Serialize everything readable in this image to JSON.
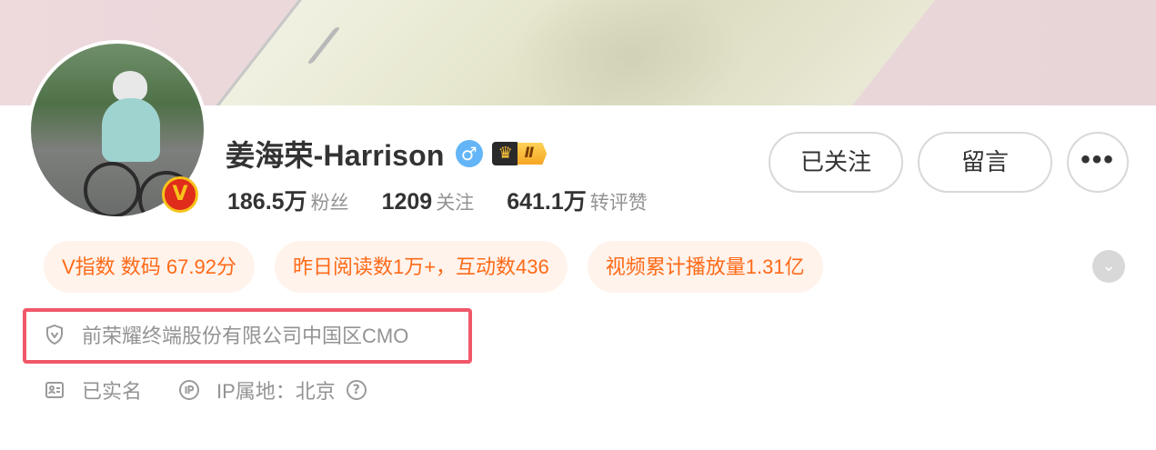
{
  "profile": {
    "name": "姜海荣-Harrison",
    "gender_icon": "male-icon",
    "level": "Ⅱ",
    "verified_badge": "V",
    "accent_color": "#ff6a18"
  },
  "stats": [
    {
      "num": "186.5万",
      "label": "粉丝"
    },
    {
      "num": "1209",
      "label": "关注"
    },
    {
      "num": "641.1万",
      "label": "转评赞"
    }
  ],
  "buttons": {
    "follow": "已关注",
    "message": "留言",
    "more": "•••"
  },
  "pills": [
    "V指数 数码 67.92分",
    "昨日阅读数1万+，互动数436",
    "视频累计播放量1.31亿"
  ],
  "info": {
    "company": "前荣耀终端股份有限公司中国区CMO",
    "real_name": "已实名",
    "ip_location": "IP属地：北京",
    "help": "?"
  }
}
